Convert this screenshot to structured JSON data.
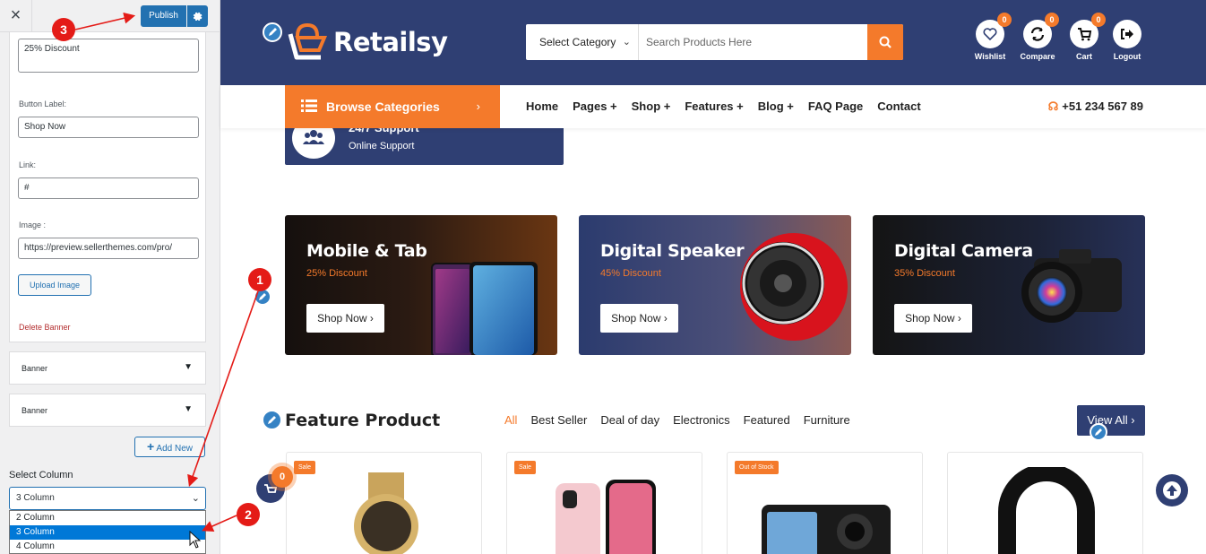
{
  "sidebar": {
    "close_label": "×",
    "publish_label": "Publish",
    "discount_value": "25% Discount",
    "button_label_label": "Button Label:",
    "button_label_value": "Shop Now",
    "link_label": "Link:",
    "link_value": "#",
    "image_label": "Image :",
    "image_value": "https://preview.sellerthemes.com/pro/",
    "upload_label": "Upload Image",
    "delete_label": "Delete Banner",
    "accordions": [
      "Banner",
      "Banner"
    ],
    "add_new_label": "Add New",
    "select_column_label": "Select Column",
    "select_column_value": "3 Column",
    "column_options": [
      "2 Column",
      "3 Column",
      "4 Column"
    ]
  },
  "header": {
    "logo_text": "Retailsy",
    "category_select": "Select Category",
    "search_placeholder": "Search Products Here",
    "icons": [
      {
        "label": "Wishlist",
        "badge": "0",
        "icon": "heart-icon"
      },
      {
        "label": "Compare",
        "badge": "0",
        "icon": "refresh-icon"
      },
      {
        "label": "Cart",
        "badge": "0",
        "icon": "cart-icon"
      },
      {
        "label": "Logout",
        "badge": "",
        "icon": "logout-icon"
      }
    ]
  },
  "nav": {
    "browse_label": "Browse Categories",
    "links": [
      "Home",
      "Pages +",
      "Shop +",
      "Features +",
      "Blog +",
      "FAQ Page",
      "Contact"
    ],
    "phone": "+51 234 567 89"
  },
  "support": {
    "title": "24/7 Support",
    "subtitle": "Online Support"
  },
  "banners": [
    {
      "title": "Mobile & Tab",
      "discount": "25% Discount",
      "button": "Shop Now ›"
    },
    {
      "title": "Digital Speaker",
      "discount": "45% Discount",
      "button": "Shop Now ›"
    },
    {
      "title": "Digital Camera",
      "discount": "35% Discount",
      "button": "Shop Now ›"
    }
  ],
  "feature": {
    "title": "Feature Product",
    "tabs": [
      "All",
      "Best Seller",
      "Deal of day",
      "Electronics",
      "Featured",
      "Furniture"
    ],
    "view_all": "View All ›",
    "cart_badge": "0",
    "cards": [
      {
        "tag": "Sale"
      },
      {
        "tag": "Sale"
      },
      {
        "tag": "Out of Stock"
      },
      {
        "tag": ""
      }
    ]
  },
  "annotations": [
    "1",
    "2",
    "3"
  ],
  "colors": {
    "navy": "#2f3f73",
    "orange": "#f47a2b",
    "wp_blue": "#2271b1",
    "annotation_red": "#e41b17"
  }
}
